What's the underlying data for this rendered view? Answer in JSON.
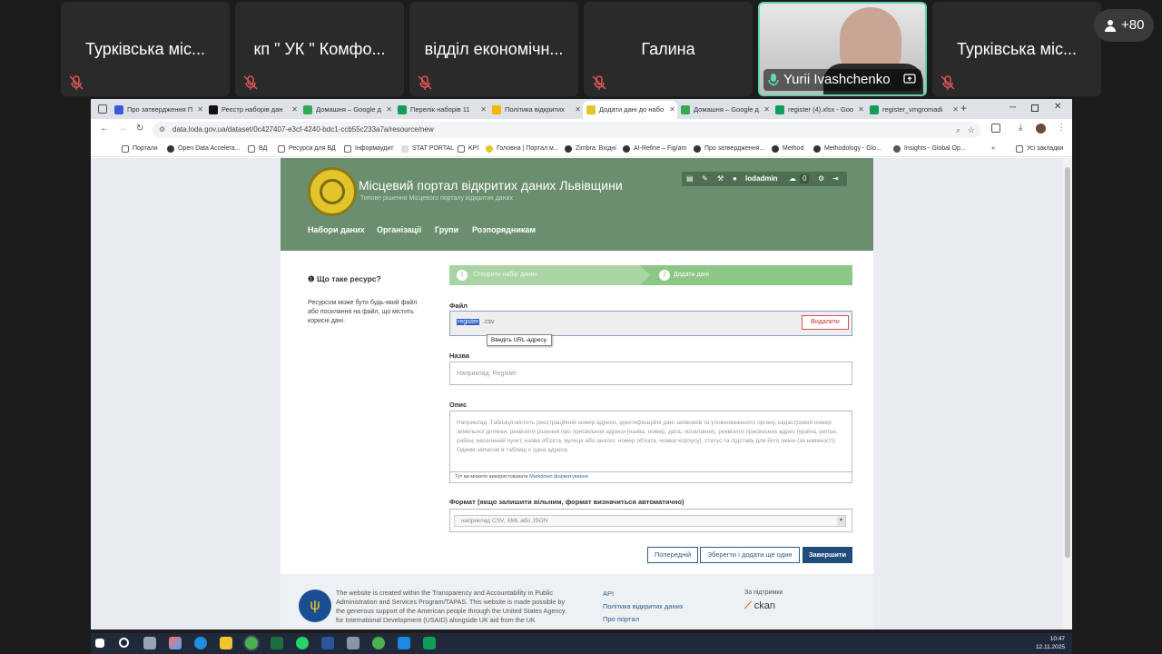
{
  "meeting": {
    "participants": [
      {
        "name": "Турківська міс..."
      },
      {
        "name": "кп \" УК \" Комфо..."
      },
      {
        "name": "відділ економічн..."
      },
      {
        "name": "Галина"
      },
      {
        "name": "Yurii Ivashchenko"
      },
      {
        "name": "Турківська міс..."
      }
    ],
    "more_count": "+80"
  },
  "browser": {
    "tabs": [
      {
        "label": "Про затвердження П",
        "color": "#3b5bdb"
      },
      {
        "label": "Реєстр наборів дан",
        "color": "#111111"
      },
      {
        "label": "Домашня – Google д",
        "color": "#34a853"
      },
      {
        "label": "Перелік наборів 11",
        "color": "#0f9d58"
      },
      {
        "label": "Політика відкритих",
        "color": "#f4b400"
      },
      {
        "label": "Додати дані до набо",
        "color": "#e2c52b"
      },
      {
        "label": "Домашня – Google д",
        "color": "#34a853"
      },
      {
        "label": "register (4).xlsx - Goo",
        "color": "#0f9d58"
      },
      {
        "label": "register_vmgromadi",
        "color": "#0f9d58"
      }
    ],
    "url": "data.loda.gov.ua/dataset/0c427407-e3cf-4240-bdc1-ccb55c233a7a/resource/new",
    "bookmarks": [
      "Портали",
      "Open Data Accelera...",
      "ВД",
      "Ресурси для ВД",
      "Інформаудит",
      "STAT PORTAL",
      "KPI",
      "Головна | Портал м...",
      "Zimbra: Вхідні",
      "AI-Refine – Fig/am",
      "Про затвердження...",
      "Method",
      "Methodology - Glo...",
      "Insights - Global Op...",
      "Усі закладки"
    ]
  },
  "site": {
    "title": "Місцевий портал відкритих даних Львівщини",
    "subtitle": "Типове рішення Місцевого порталу відкритих даних",
    "nav": [
      "Набори даних",
      "Організації",
      "Групи",
      "Розпорядникам"
    ],
    "user": "lodadmin",
    "notifications": "0"
  },
  "sidebar": {
    "heading": "Що таке ресурс?",
    "text": "Ресурсом може бути будь-який файл або посилання на файл, що містить корисні дані."
  },
  "stages": {
    "step1_num": "1",
    "step1_label": "Створити набір даних",
    "step2_num": "2",
    "step2_label": "Додати дані"
  },
  "form": {
    "file_label": "Файл",
    "file_selected": "register",
    "file_rest": ".csv",
    "remove_label": "Видалити",
    "tooltip": "Введіть URL-адресу.",
    "name_label": "Назва",
    "name_placeholder": "Наприклад: Register",
    "desc_label": "Опис",
    "desc_placeholder": "Наприклад: Таблиця містить реєстраційний номер адреси, ідентифікаційні дані заявників та уповноваженого органу, кадастровий номер земельної ділянки, реквізити рішення про присвоєння адреси (назва, номер, дата, посилання), реквізити присвоєних адрес (країна, регіон, район, населений пункт, назва об'єкта, вулиця або аналог, номер об'єкта, номер корпусу), статус та підставу для його зміни (за наявності). Одним записом в таблиці є одна адреса.",
    "md_hint": "Тут ви можете використовувати",
    "md_link": "Markdown форматування",
    "format_label": "Формат (якщо залишити вільним, формат визначиться автоматично)",
    "format_placeholder": "наприклад CSV, XML або JSON",
    "btn_prev": "Попередній",
    "btn_save_add": "Зберегти і додати ще один",
    "btn_finish": "Завершити"
  },
  "footer": {
    "text": "The website is created within the Transparency and Accountability in Public Administration and Services Program/TAPAS. This website is made possible by the generous support of the American people through the United States Agency for International Development (USAID) alongside UK aid from the UK",
    "links": [
      "API",
      "Політика відкритих даних",
      "Про портал"
    ],
    "supported_by": "За підтримки",
    "ckan": "ckan"
  },
  "taskbar": {
    "time": "10:47",
    "date": "12.11.2025"
  }
}
